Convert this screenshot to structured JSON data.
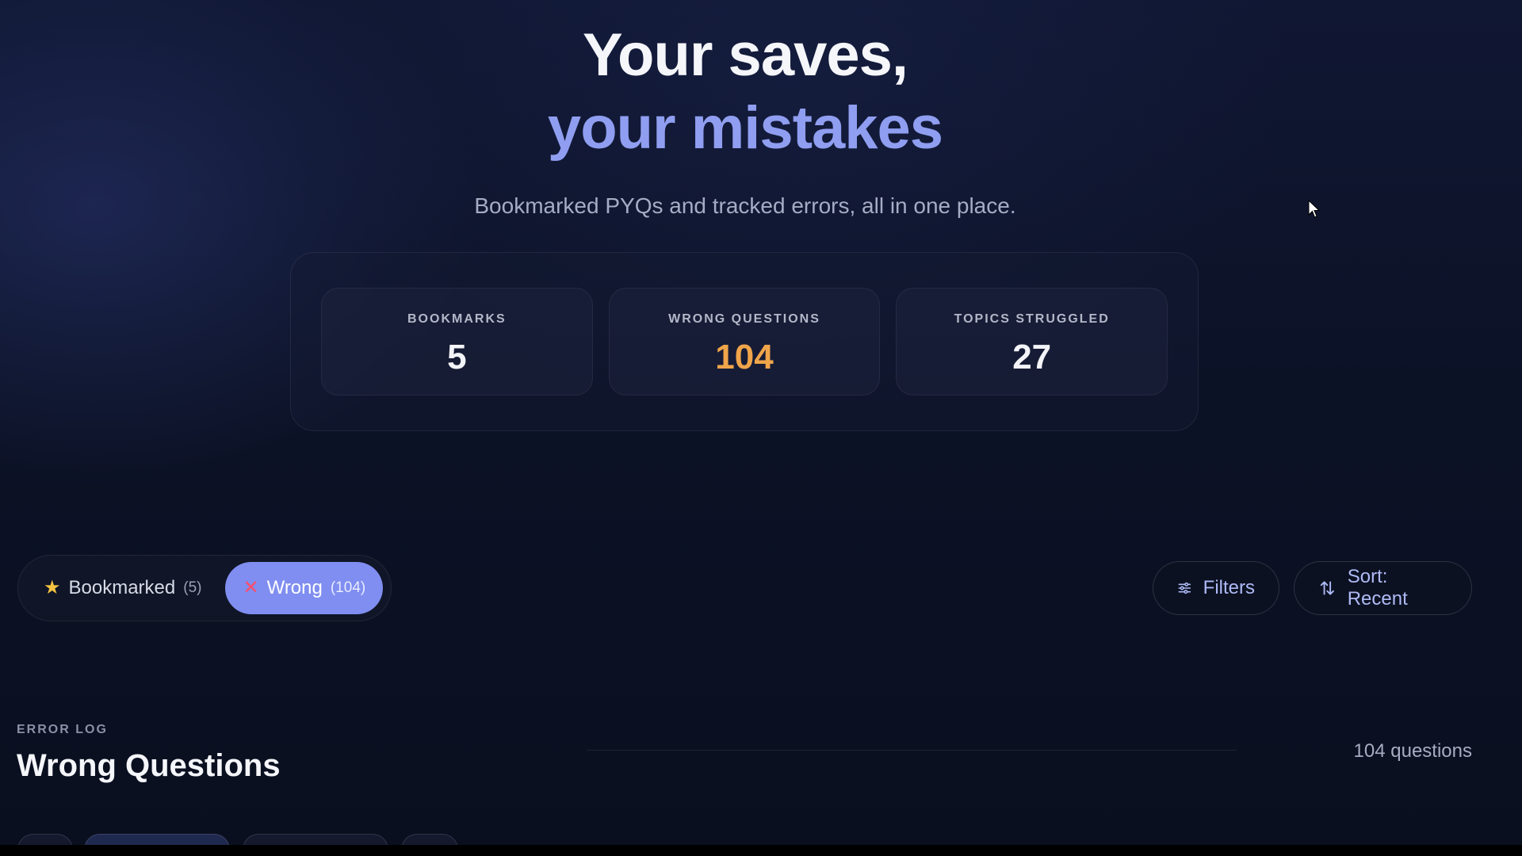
{
  "hero": {
    "title_line1": "Your saves,",
    "title_line2": "your mistakes",
    "subtitle": "Bookmarked PYQs and tracked errors, all in one place."
  },
  "stats": [
    {
      "label": "BOOKMARKS",
      "value": "5"
    },
    {
      "label": "WRONG QUESTIONS",
      "value": "104"
    },
    {
      "label": "TOPICS STRUGGLED",
      "value": "27"
    }
  ],
  "toggle": {
    "bookmarked": {
      "label": "Bookmarked",
      "count": "(5)",
      "icon": "star-icon"
    },
    "wrong": {
      "label": "Wrong",
      "count": "(104)",
      "icon": "x-icon"
    }
  },
  "toolbar": {
    "filters_label": "Filters",
    "sort_label": "Sort: Recent"
  },
  "error_log": {
    "eyebrow": "ERROR LOG",
    "title": "Wrong Questions",
    "count_text": "104 questions"
  },
  "colors": {
    "accent": "#7f8ef0",
    "title_accent": "#8f9ef0",
    "warning": "#f0a54a",
    "background": "#0b1020"
  }
}
